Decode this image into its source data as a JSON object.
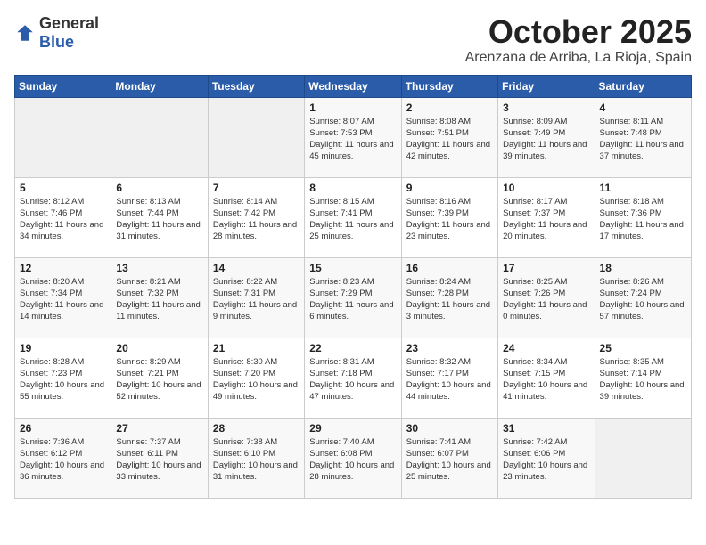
{
  "logo": {
    "general": "General",
    "blue": "Blue"
  },
  "header": {
    "month": "October 2025",
    "location": "Arenzana de Arriba, La Rioja, Spain"
  },
  "weekdays": [
    "Sunday",
    "Monday",
    "Tuesday",
    "Wednesday",
    "Thursday",
    "Friday",
    "Saturday"
  ],
  "weeks": [
    [
      {
        "day": "",
        "sunrise": "",
        "sunset": "",
        "daylight": ""
      },
      {
        "day": "",
        "sunrise": "",
        "sunset": "",
        "daylight": ""
      },
      {
        "day": "",
        "sunrise": "",
        "sunset": "",
        "daylight": ""
      },
      {
        "day": "1",
        "sunrise": "Sunrise: 8:07 AM",
        "sunset": "Sunset: 7:53 PM",
        "daylight": "Daylight: 11 hours and 45 minutes."
      },
      {
        "day": "2",
        "sunrise": "Sunrise: 8:08 AM",
        "sunset": "Sunset: 7:51 PM",
        "daylight": "Daylight: 11 hours and 42 minutes."
      },
      {
        "day": "3",
        "sunrise": "Sunrise: 8:09 AM",
        "sunset": "Sunset: 7:49 PM",
        "daylight": "Daylight: 11 hours and 39 minutes."
      },
      {
        "day": "4",
        "sunrise": "Sunrise: 8:11 AM",
        "sunset": "Sunset: 7:48 PM",
        "daylight": "Daylight: 11 hours and 37 minutes."
      }
    ],
    [
      {
        "day": "5",
        "sunrise": "Sunrise: 8:12 AM",
        "sunset": "Sunset: 7:46 PM",
        "daylight": "Daylight: 11 hours and 34 minutes."
      },
      {
        "day": "6",
        "sunrise": "Sunrise: 8:13 AM",
        "sunset": "Sunset: 7:44 PM",
        "daylight": "Daylight: 11 hours and 31 minutes."
      },
      {
        "day": "7",
        "sunrise": "Sunrise: 8:14 AM",
        "sunset": "Sunset: 7:42 PM",
        "daylight": "Daylight: 11 hours and 28 minutes."
      },
      {
        "day": "8",
        "sunrise": "Sunrise: 8:15 AM",
        "sunset": "Sunset: 7:41 PM",
        "daylight": "Daylight: 11 hours and 25 minutes."
      },
      {
        "day": "9",
        "sunrise": "Sunrise: 8:16 AM",
        "sunset": "Sunset: 7:39 PM",
        "daylight": "Daylight: 11 hours and 23 minutes."
      },
      {
        "day": "10",
        "sunrise": "Sunrise: 8:17 AM",
        "sunset": "Sunset: 7:37 PM",
        "daylight": "Daylight: 11 hours and 20 minutes."
      },
      {
        "day": "11",
        "sunrise": "Sunrise: 8:18 AM",
        "sunset": "Sunset: 7:36 PM",
        "daylight": "Daylight: 11 hours and 17 minutes."
      }
    ],
    [
      {
        "day": "12",
        "sunrise": "Sunrise: 8:20 AM",
        "sunset": "Sunset: 7:34 PM",
        "daylight": "Daylight: 11 hours and 14 minutes."
      },
      {
        "day": "13",
        "sunrise": "Sunrise: 8:21 AM",
        "sunset": "Sunset: 7:32 PM",
        "daylight": "Daylight: 11 hours and 11 minutes."
      },
      {
        "day": "14",
        "sunrise": "Sunrise: 8:22 AM",
        "sunset": "Sunset: 7:31 PM",
        "daylight": "Daylight: 11 hours and 9 minutes."
      },
      {
        "day": "15",
        "sunrise": "Sunrise: 8:23 AM",
        "sunset": "Sunset: 7:29 PM",
        "daylight": "Daylight: 11 hours and 6 minutes."
      },
      {
        "day": "16",
        "sunrise": "Sunrise: 8:24 AM",
        "sunset": "Sunset: 7:28 PM",
        "daylight": "Daylight: 11 hours and 3 minutes."
      },
      {
        "day": "17",
        "sunrise": "Sunrise: 8:25 AM",
        "sunset": "Sunset: 7:26 PM",
        "daylight": "Daylight: 11 hours and 0 minutes."
      },
      {
        "day": "18",
        "sunrise": "Sunrise: 8:26 AM",
        "sunset": "Sunset: 7:24 PM",
        "daylight": "Daylight: 10 hours and 57 minutes."
      }
    ],
    [
      {
        "day": "19",
        "sunrise": "Sunrise: 8:28 AM",
        "sunset": "Sunset: 7:23 PM",
        "daylight": "Daylight: 10 hours and 55 minutes."
      },
      {
        "day": "20",
        "sunrise": "Sunrise: 8:29 AM",
        "sunset": "Sunset: 7:21 PM",
        "daylight": "Daylight: 10 hours and 52 minutes."
      },
      {
        "day": "21",
        "sunrise": "Sunrise: 8:30 AM",
        "sunset": "Sunset: 7:20 PM",
        "daylight": "Daylight: 10 hours and 49 minutes."
      },
      {
        "day": "22",
        "sunrise": "Sunrise: 8:31 AM",
        "sunset": "Sunset: 7:18 PM",
        "daylight": "Daylight: 10 hours and 47 minutes."
      },
      {
        "day": "23",
        "sunrise": "Sunrise: 8:32 AM",
        "sunset": "Sunset: 7:17 PM",
        "daylight": "Daylight: 10 hours and 44 minutes."
      },
      {
        "day": "24",
        "sunrise": "Sunrise: 8:34 AM",
        "sunset": "Sunset: 7:15 PM",
        "daylight": "Daylight: 10 hours and 41 minutes."
      },
      {
        "day": "25",
        "sunrise": "Sunrise: 8:35 AM",
        "sunset": "Sunset: 7:14 PM",
        "daylight": "Daylight: 10 hours and 39 minutes."
      }
    ],
    [
      {
        "day": "26",
        "sunrise": "Sunrise: 7:36 AM",
        "sunset": "Sunset: 6:12 PM",
        "daylight": "Daylight: 10 hours and 36 minutes."
      },
      {
        "day": "27",
        "sunrise": "Sunrise: 7:37 AM",
        "sunset": "Sunset: 6:11 PM",
        "daylight": "Daylight: 10 hours and 33 minutes."
      },
      {
        "day": "28",
        "sunrise": "Sunrise: 7:38 AM",
        "sunset": "Sunset: 6:10 PM",
        "daylight": "Daylight: 10 hours and 31 minutes."
      },
      {
        "day": "29",
        "sunrise": "Sunrise: 7:40 AM",
        "sunset": "Sunset: 6:08 PM",
        "daylight": "Daylight: 10 hours and 28 minutes."
      },
      {
        "day": "30",
        "sunrise": "Sunrise: 7:41 AM",
        "sunset": "Sunset: 6:07 PM",
        "daylight": "Daylight: 10 hours and 25 minutes."
      },
      {
        "day": "31",
        "sunrise": "Sunrise: 7:42 AM",
        "sunset": "Sunset: 6:06 PM",
        "daylight": "Daylight: 10 hours and 23 minutes."
      },
      {
        "day": "",
        "sunrise": "",
        "sunset": "",
        "daylight": ""
      }
    ]
  ]
}
